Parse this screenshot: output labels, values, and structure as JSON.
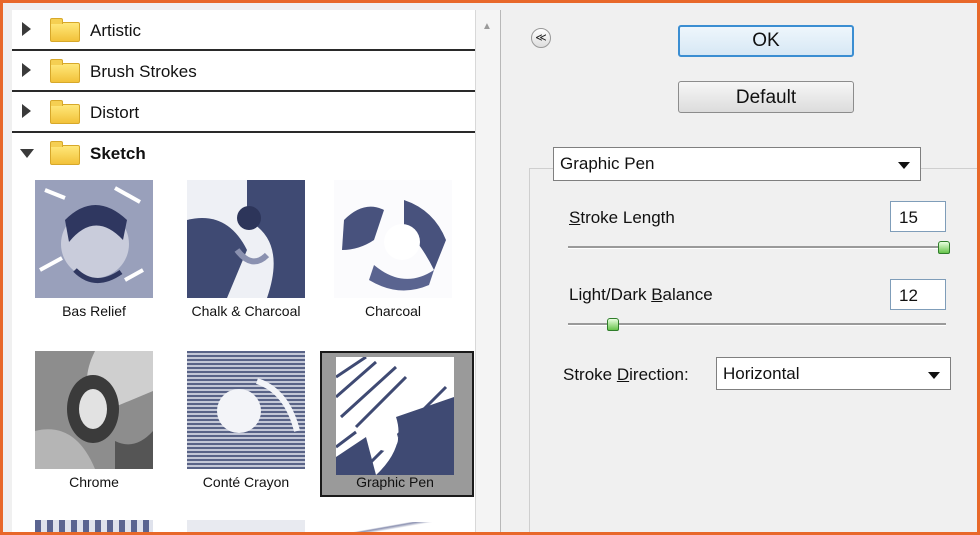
{
  "categories": [
    {
      "label": "Artistic",
      "expanded": false
    },
    {
      "label": "Brush Strokes",
      "expanded": false
    },
    {
      "label": "Distort",
      "expanded": false
    },
    {
      "label": "Sketch",
      "expanded": true
    }
  ],
  "thumbnails": [
    {
      "label": "Bas Relief",
      "icon": "bas-relief-thumbnail"
    },
    {
      "label": "Chalk & Charcoal",
      "icon": "chalk-charcoal-thumbnail"
    },
    {
      "label": "Charcoal",
      "icon": "charcoal-thumbnail"
    },
    {
      "label": "Chrome",
      "icon": "chrome-thumbnail"
    },
    {
      "label": "Conté Crayon",
      "icon": "conte-crayon-thumbnail"
    },
    {
      "label": "Graphic Pen",
      "icon": "graphic-pen-thumbnail",
      "selected": true
    }
  ],
  "buttons": {
    "ok": "OK",
    "default": "Default"
  },
  "filter_select": {
    "value": "Graphic Pen"
  },
  "params": {
    "stroke_length": {
      "label": "Stroke Length",
      "value": "15",
      "fraction": 1.0
    },
    "balance": {
      "label": "Light/Dark Balance",
      "value": "12",
      "fraction": 0.12
    },
    "direction": {
      "label": "Stroke Direction:",
      "value": "Horizontal"
    }
  },
  "colors": {
    "accent_border": "#e8682a",
    "ok_border": "#3b8ed2",
    "thumb_ink": "#3f4a73"
  }
}
